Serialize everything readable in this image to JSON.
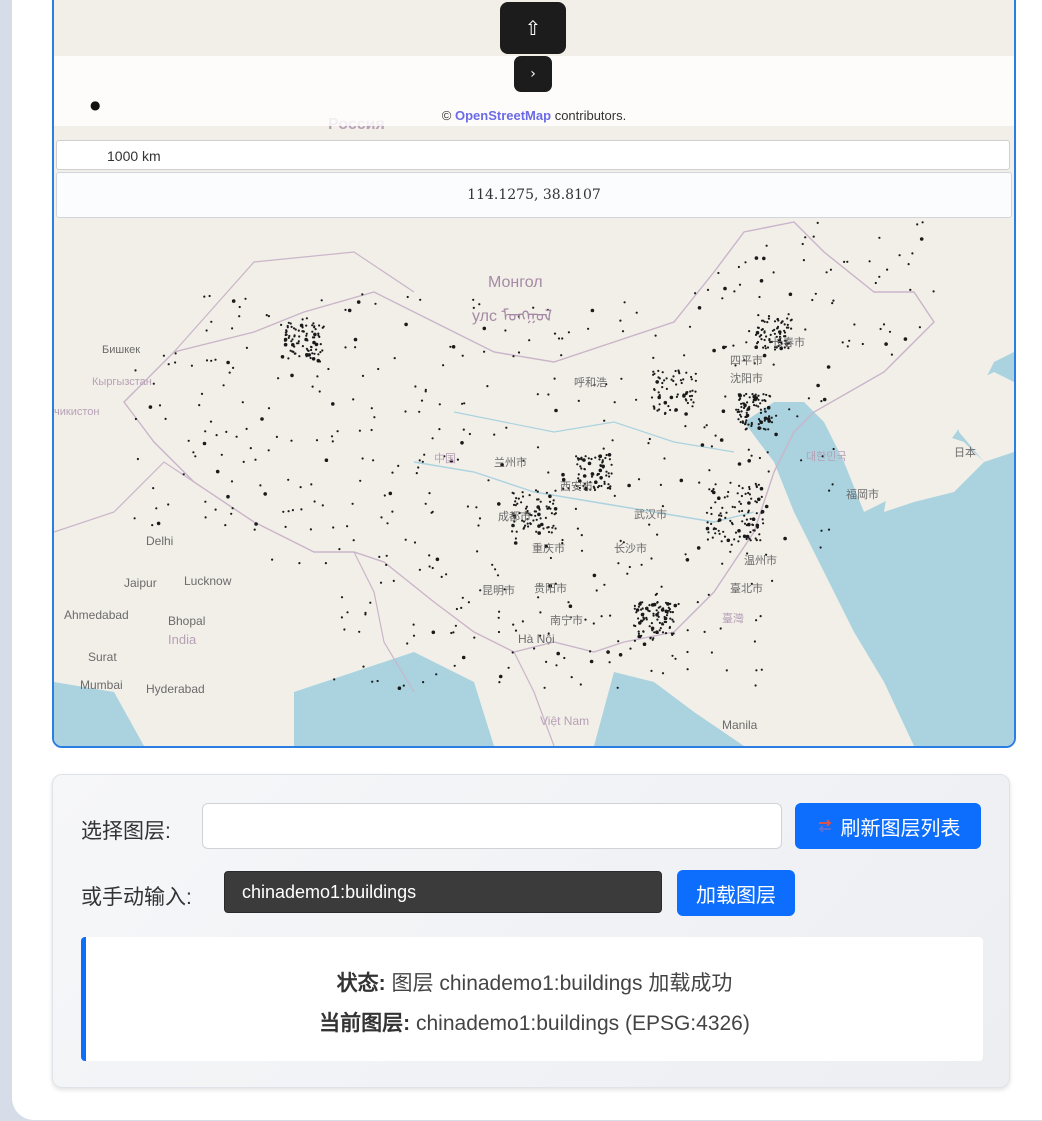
{
  "map": {
    "controls": {
      "up_glyph": "⇧",
      "next_glyph": "›"
    },
    "attribution": {
      "prefix": "©",
      "link_text": "OpenStreetMap",
      "suffix": "contributors."
    },
    "scale_label": "1000 km",
    "coordinate_readout": "114.1275,  38.8107",
    "labels": {
      "russia": "Россия",
      "mongolia_1": "Монгол",
      "mongolia_2": "улс ᠮᠣᠩᠭᠣᠯ",
      "bishkek": "Бишкек",
      "kyrgyzstan": "Кыргызстан",
      "tajikistan": "чикистон",
      "delhi": "Delhi",
      "jaipur": "Jaipur",
      "lucknow": "Lucknow",
      "ahmedabad": "Ahmedabad",
      "bhopal": "Bhopal",
      "india": "India",
      "surat": "Surat",
      "mumbai": "Mumbai",
      "hyderabad": "Hyderabad",
      "ha_noi": "Hà Nội",
      "viet_nam": "Việt Nam",
      "manila": "Manila",
      "fukuoka": "福岡市",
      "japan": "日本",
      "korea": "대한민국",
      "zhongguo": "中国",
      "changchun": "长春市",
      "siping": "四平市",
      "shenyang": "沈阳市",
      "hohhot": "呼和浩",
      "lanzhou": "兰州市",
      "xian": "西安市",
      "chengdu": "成都市",
      "chongqing": "重庆市",
      "wuhan": "武汉市",
      "changsha": "长沙市",
      "kunming": "昆明市",
      "guiyang": "贵阳市",
      "nanning": "南宁市",
      "taipei": "臺北市",
      "wenzhou": "温州市",
      "taiwan": "臺灣"
    }
  },
  "panel": {
    "select_label": "选择图层:",
    "select_value": "",
    "refresh_button": "刷新图层列表",
    "manual_label": "或手动输入:",
    "manual_value": "chinademo1:buildings",
    "load_button": "加载图层",
    "status": {
      "status_key": "状态:",
      "status_value": "图层 chinademo1:buildings 加载成功",
      "current_key": "当前图层:",
      "current_value": "chinademo1:buildings (EPSG:4326)"
    }
  },
  "colors": {
    "accent": "#0d6efd",
    "map_border": "#2a7de1",
    "land": "#f2efe9",
    "water": "#aad3df",
    "points": "#1a1a1a"
  }
}
